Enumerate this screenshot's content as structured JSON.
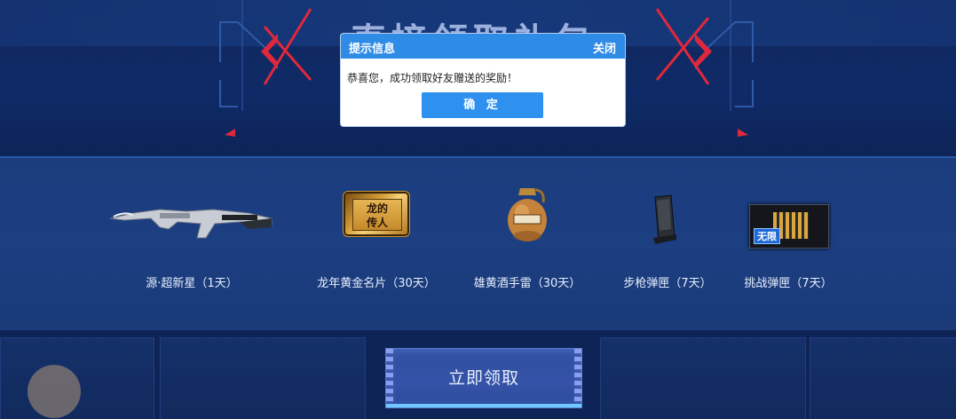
{
  "banner": {
    "title": "直接领取礼包"
  },
  "dialog": {
    "title": "提示信息",
    "close_label": "关闭",
    "message": "恭喜您，成功领取好友赠送的奖励！",
    "confirm_label": "确 定"
  },
  "rewards": [
    {
      "label": "源·超新星（1天）",
      "icon": "rifle-icon"
    },
    {
      "label": "龙年黄金名片（30天）",
      "icon": "gold-card-icon",
      "card_text_1": "龙的",
      "card_text_2": "传人"
    },
    {
      "label": "雄黄酒手雷（30天）",
      "icon": "grenade-icon"
    },
    {
      "label": "步枪弹匣（7天）",
      "icon": "magazine-icon"
    },
    {
      "label": "挑战弹匣（7天）",
      "icon": "challenge-magazine-icon",
      "badge": "无限"
    }
  ],
  "cta": {
    "label": "立即领取"
  },
  "colors": {
    "dialog_header": "#2f8ce6",
    "confirm_button": "#2f91ef",
    "page_background": "#0f2458",
    "accent_red": "#e0283c"
  }
}
